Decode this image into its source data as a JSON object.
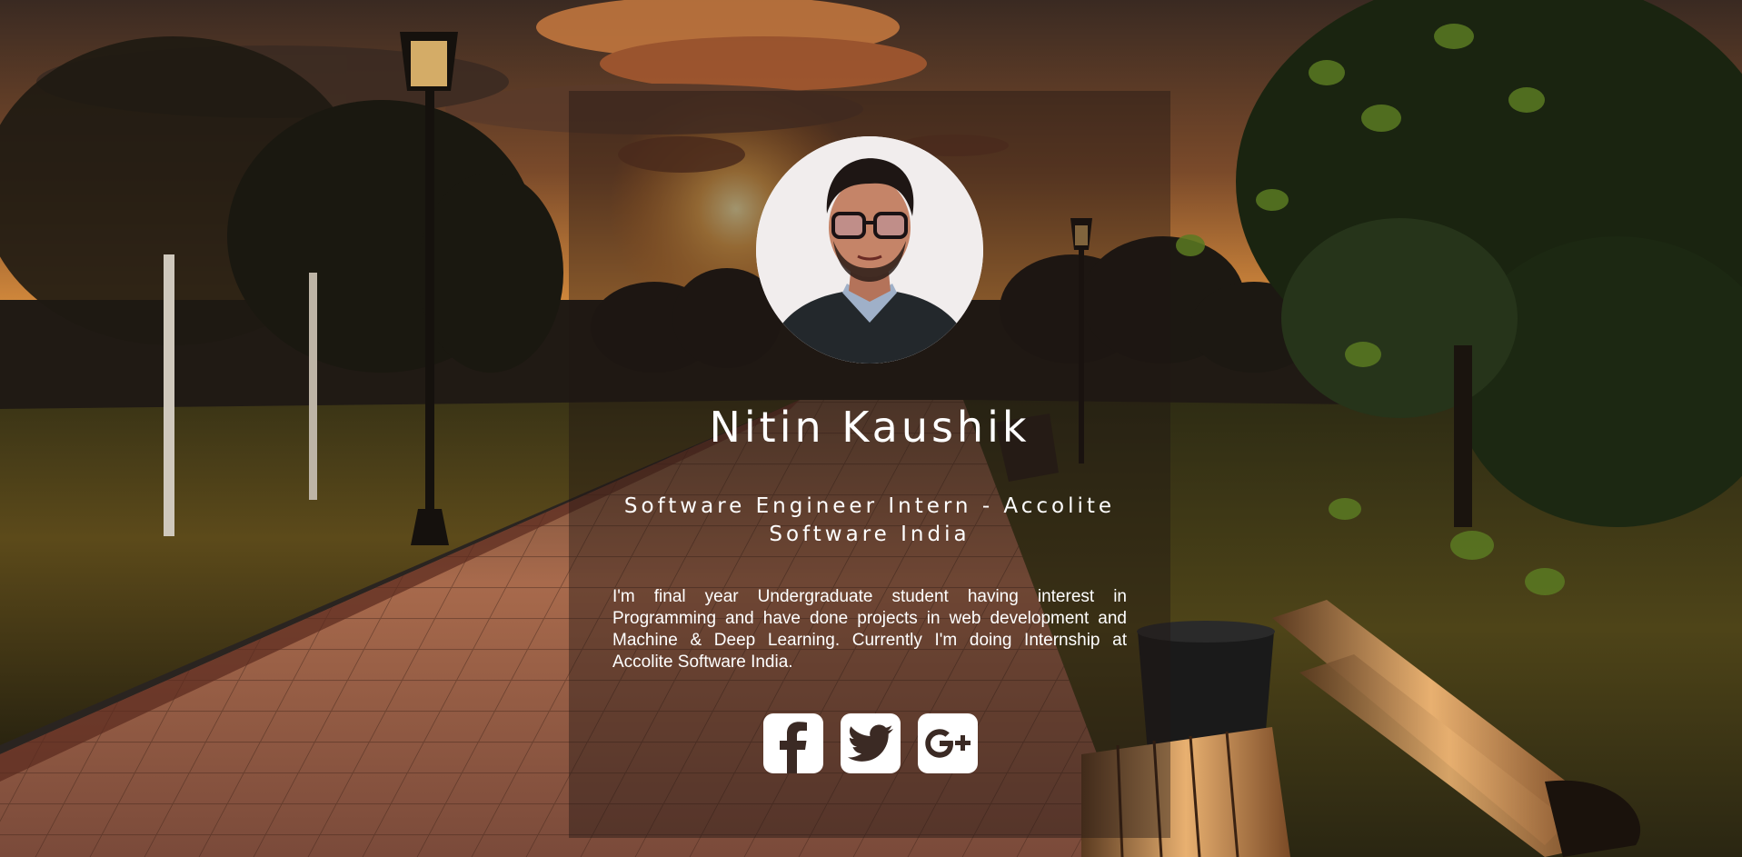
{
  "profile": {
    "name": "Nitin Kaushik",
    "role": "Software Engineer Intern - Accolite Software India",
    "bio": "I'm final year Undergraduate student having interest in Programming and have done projects in web development and Machine & Deep Learning. Currently I'm doing Internship at Accolite Software India.",
    "avatar_icon": "profile-photo"
  },
  "social_links": [
    {
      "network": "Facebook",
      "icon": "facebook-icon"
    },
    {
      "network": "Twitter",
      "icon": "twitter-icon"
    },
    {
      "network": "Google+",
      "icon": "google-plus-icon"
    }
  ],
  "colors": {
    "text": "#ffffff",
    "icon_background": "#ffffff",
    "icon_glyph": "#3b2a24",
    "card_overlay": "rgba(30,22,18,0.42)"
  }
}
